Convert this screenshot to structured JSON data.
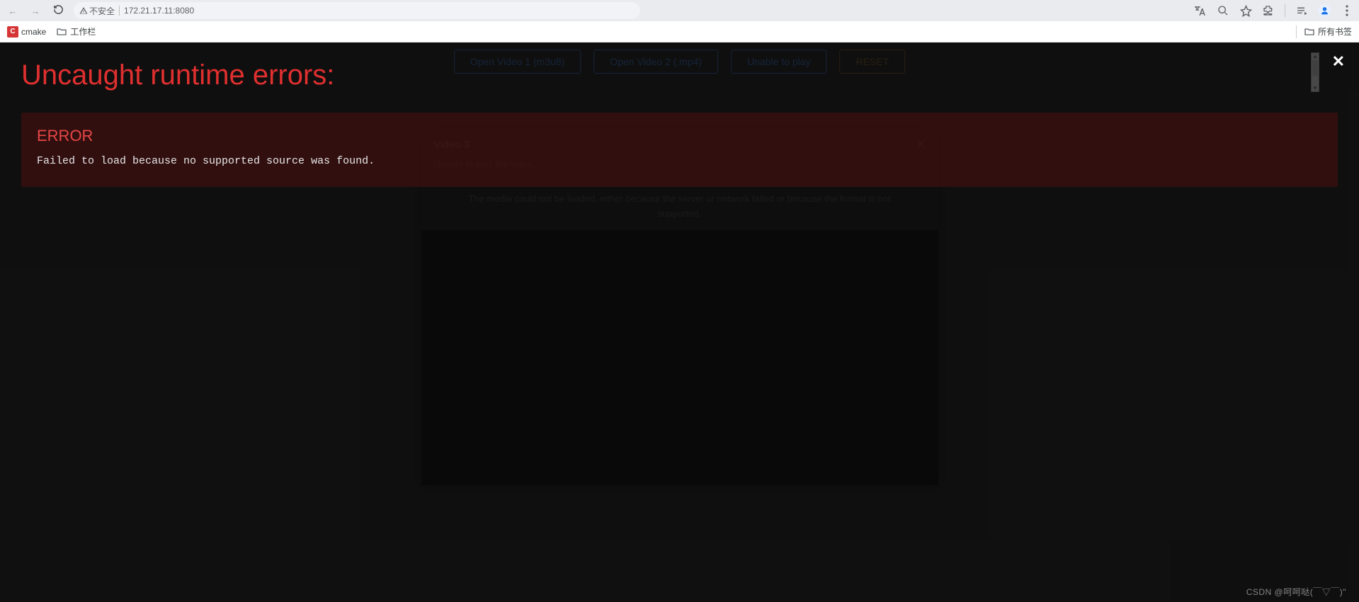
{
  "browser": {
    "security_label": "不安全",
    "url": "172.21.17.11:8080"
  },
  "bookmarks": {
    "items": [
      {
        "label": "cmake",
        "favicon_letter": "C"
      },
      {
        "label": "工作栏"
      }
    ],
    "all_label": "所有书签"
  },
  "app": {
    "buttons": {
      "open1": "Open Video 1 (m3u8)",
      "open2": "Open Video 2 (.mp4)",
      "unable": "Unable to play",
      "reset": "RESET"
    },
    "dialog": {
      "title": "Video 3",
      "unable_msg": "Unable to play the video.",
      "media_msg": "The media could not be loaded, either because the server or network failed or because the format is not supported."
    }
  },
  "overlay": {
    "title": "Uncaught runtime errors:",
    "error_label": "ERROR",
    "error_text": "Failed to load because no supported source was found."
  },
  "watermark": "CSDN @呵呵哒(￣▽￣)\""
}
